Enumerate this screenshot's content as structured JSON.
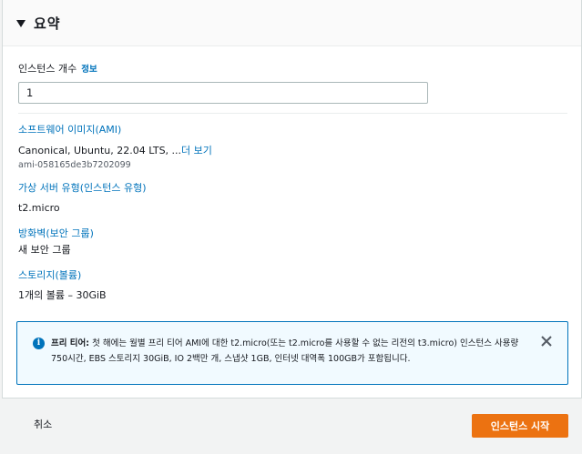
{
  "summary": {
    "title": "요약"
  },
  "instance_count": {
    "label": "인스턴스 개수",
    "info_link": "정보",
    "value": "1"
  },
  "software_image": {
    "title": "소프트웨어 이미지(AMI)",
    "value": "Canonical, Ubuntu, 22.04 LTS, ...",
    "more_link": "더 보기",
    "ami_id": "ami-058165de3b7202099"
  },
  "server_type": {
    "title": "가상 서버 유형(인스턴스 유형)",
    "value": "t2.micro"
  },
  "firewall": {
    "title": "방화벽(보안 그룹)",
    "value": "새 보안 그룹"
  },
  "storage": {
    "title": "스토리지(볼륨)",
    "value": "1개의 볼륨 – 30GiB"
  },
  "free_tier": {
    "label": "프리 티어:",
    "text": " 첫 해에는 월별 프리 티어 AMI에 대한 t2.micro(또는 t2.micro를 사용할 수 없는 리전의 t3.micro) 인스턴스 사용량 750시간, EBS 스토리지 30GiB, IO 2백만 개, 스냅샷 1GB, 인터넷 대역폭 100GB가 포함됩니다.",
    "info_icon": "info-icon",
    "close_icon": "close-icon"
  },
  "footer": {
    "cancel_label": "취소",
    "launch_label": "인스턴스 시작"
  },
  "colors": {
    "link": "#0073bb",
    "primary_button": "#ec7211",
    "info_background": "#f1faff",
    "text": "#16191f"
  }
}
